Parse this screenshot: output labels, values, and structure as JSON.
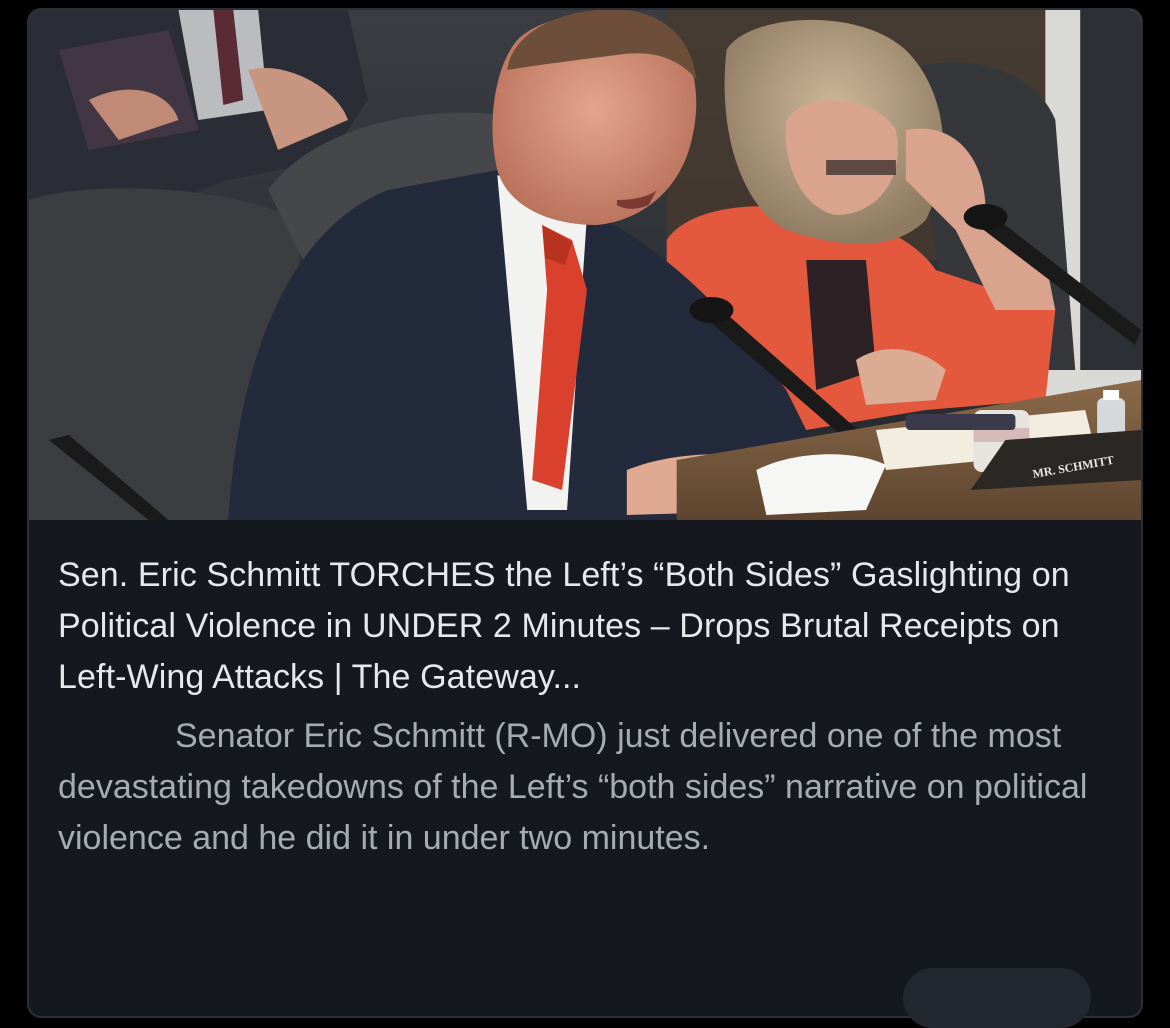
{
  "post_card": {
    "image": {
      "description_icon": "hearing-photo-icon",
      "nameplate": "MR. SCHMITT"
    },
    "title": "Sen. Eric Schmitt TORCHES the Left’s “Both Sides” Gaslighting on Political Violence in UNDER 2 Minutes – Drops Brutal Receipts on Left-Wing Attacks | The Gateway...",
    "description": "Senator Eric Schmitt (R-MO) just delivered one of the most devastating takedowns of the Left’s “both sides” narrative on political violence and he did it in under two minutes."
  },
  "colors": {
    "background": "#000000",
    "card": "#15181e",
    "title_text": "#e6e8ec",
    "description_text": "#a7abb3",
    "tie": "#d9412e",
    "jacket_orange": "#e4583e"
  }
}
